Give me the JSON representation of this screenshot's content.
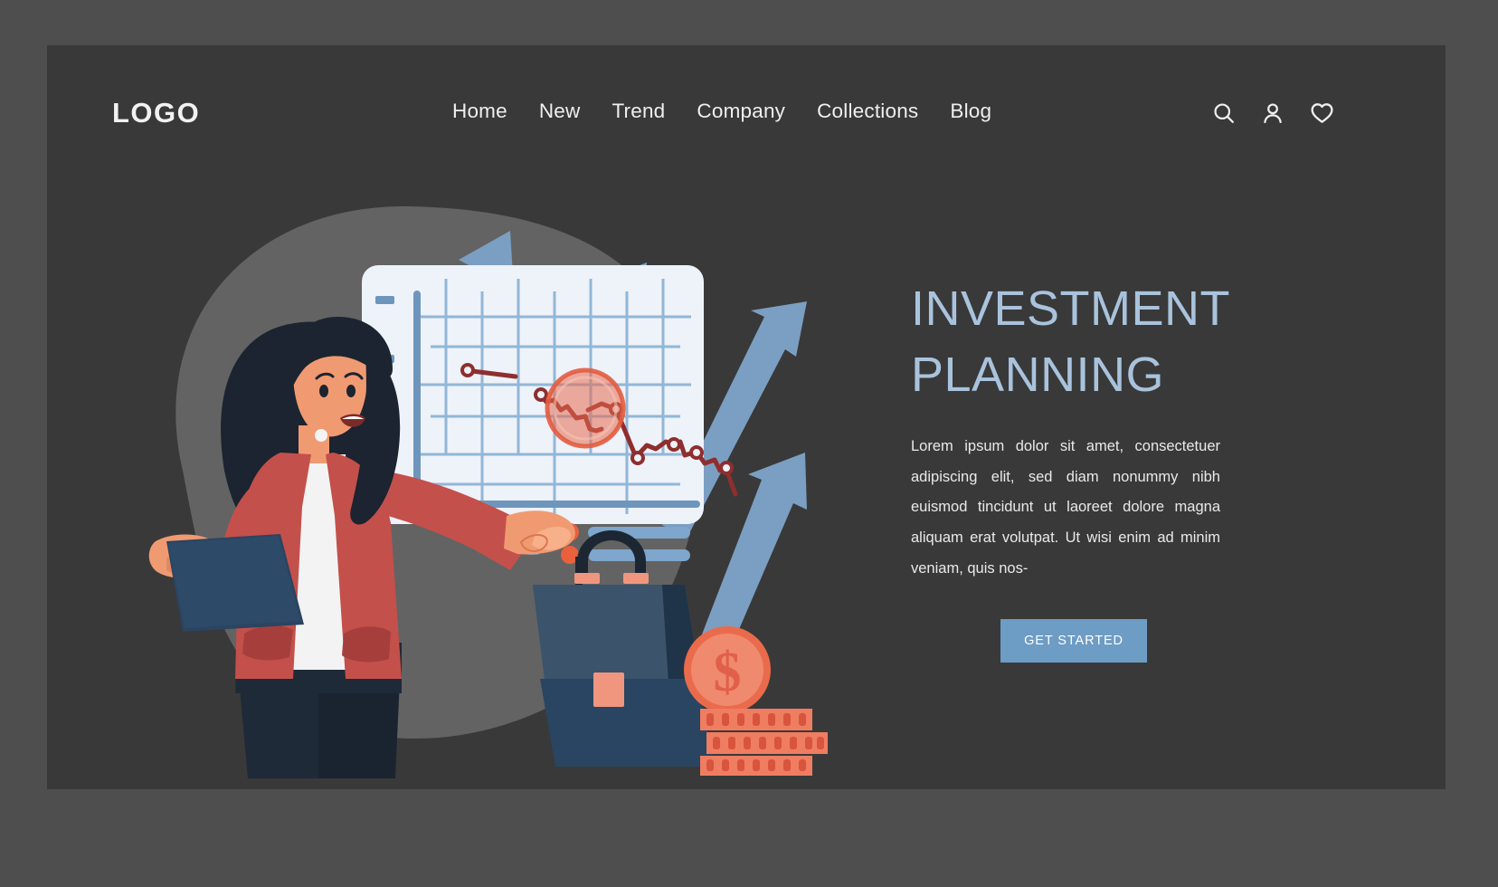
{
  "header": {
    "logo": "LOGO",
    "nav": [
      {
        "label": "Home"
      },
      {
        "label": "New"
      },
      {
        "label": "Trend"
      },
      {
        "label": "Company"
      },
      {
        "label": "Collections"
      },
      {
        "label": "Blog"
      }
    ],
    "icons": [
      {
        "name": "search-icon"
      },
      {
        "name": "user-icon"
      },
      {
        "name": "heart-icon"
      }
    ]
  },
  "hero": {
    "headline": "INVESTMENT PLANNING",
    "headline_line1": "INVESTMENT",
    "headline_line2": "PLANNING",
    "body": "Lorem ipsum dolor sit amet, consectetuer adipiscing elit, sed diam nonummy nibh euismod tincidunt ut laoreet dolore magna aliquam erat volutpat. Ut wisi enim ad minim veniam, quis nos-",
    "cta_label": "GET STARTED"
  },
  "colors": {
    "page_background": "#4e4e4e",
    "canvas_background": "#393939",
    "headline": "#a9c3dd",
    "body_text": "#e9e9e9",
    "cta_background": "#6d9cc4",
    "cta_text": "#ffffff",
    "nav_text": "#efefef",
    "blob": "#6b6b6b",
    "arrow_blue": "#7b9fc2",
    "board_white": "#eef2f9",
    "grid_blue": "#8db4d6",
    "axis_blue": "#6e96bc",
    "line_red": "#8f2e2e",
    "accent_coral": "#ee7055",
    "coin_coral": "#ef8268",
    "briefcase_navy": "#3b536b",
    "briefcase_dark": "#27415a",
    "jacket_red": "#c4504b",
    "hair_dark": "#1b2430",
    "skin": "#f59a72",
    "laptop_navy": "#2b4460",
    "pants_dark": "#1f2a38"
  },
  "illustration": {
    "chart_board": {
      "legend_rows": 2,
      "y_axis_ticks": 3
    },
    "elements": [
      {
        "name": "woman-character"
      },
      {
        "name": "laptop"
      },
      {
        "name": "chart-board"
      },
      {
        "name": "magnifier-circle"
      },
      {
        "name": "briefcase"
      },
      {
        "name": "dollar-coin"
      },
      {
        "name": "coin-stack"
      },
      {
        "name": "growth-arrows"
      }
    ]
  },
  "chart_data": {
    "type": "line",
    "title": "",
    "xlabel": "",
    "ylabel": "",
    "grid": true,
    "legend_position": "bottom",
    "series": [
      {
        "name": "declining-trend",
        "x": [
          0.5,
          2.4,
          3.0,
          3.6,
          4.3,
          5.0,
          5.8,
          7.6,
          8.6,
          9.6,
          10.6,
          11.4,
          12.3
        ],
        "values": [
          8.2,
          7.2,
          6.6,
          6.6,
          5.8,
          5.1,
          5.4,
          3.6,
          4.0,
          3.0,
          2.8,
          2.5,
          1.6
        ]
      }
    ],
    "xlim": [
      0,
      13
    ],
    "ylim": [
      0,
      9
    ]
  }
}
